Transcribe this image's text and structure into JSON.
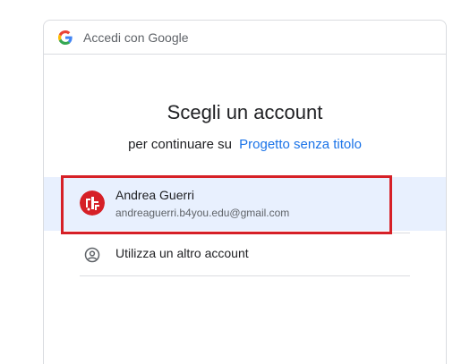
{
  "header": {
    "label": "Accedi con Google",
    "logo_icon": "google-g-icon"
  },
  "main": {
    "title": "Scegli un account",
    "subtitle_prefix": "per continuare su",
    "subtitle_link": "Progetto senza titolo"
  },
  "accounts": [
    {
      "name": "Andrea Guerri",
      "email": "andreaguerri.b4you.edu@gmail.com",
      "avatar_icon": "avatar-icon",
      "selected": true
    }
  ],
  "other_account": {
    "label": "Utilizza un altro account",
    "icon": "person-circle-icon"
  },
  "colors": {
    "link": "#1a73e8",
    "selected_row": "#e8f0fe",
    "highlight": "#d62027",
    "avatar": "#d62027",
    "border": "#dadce0"
  }
}
